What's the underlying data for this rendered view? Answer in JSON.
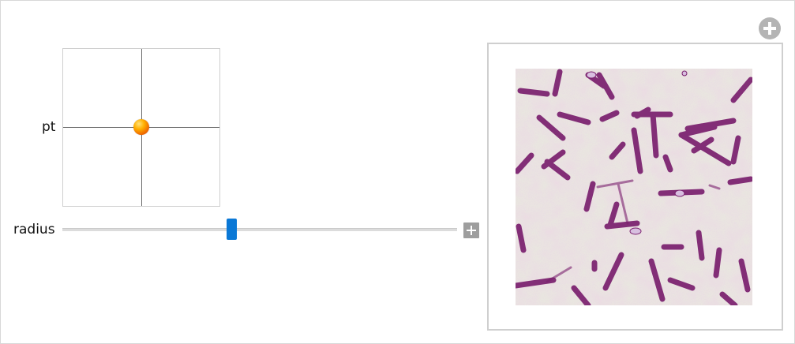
{
  "controls": {
    "pt_label": "pt",
    "radius_label": "radius",
    "radius_slider": {
      "value_fraction": 0.42
    }
  },
  "icons": {
    "slider_plus": "plus-square-icon",
    "add_panel": "plus-circle-icon"
  },
  "colors": {
    "slider_thumb": "#0a78d6",
    "locator_dot": "#ff9a00",
    "rod_stain": "#7a1f6e",
    "background_stain": "#e9ecdf"
  }
}
